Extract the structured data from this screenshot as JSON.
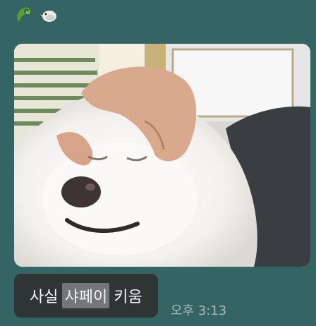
{
  "reactions": [
    {
      "icon": "crocodile-emoji-icon"
    },
    {
      "icon": "bird-emoji-icon"
    }
  ],
  "message": {
    "photo_icon": "dog-photo",
    "text_before": "사실",
    "text_highlight": "샤페이",
    "text_after": "키움",
    "timestamp": "오후 3:13"
  },
  "colors": {
    "background": "#356464",
    "bubble": "#2f3434",
    "highlight": "#737778",
    "timestamp": "#a8b9b8"
  }
}
